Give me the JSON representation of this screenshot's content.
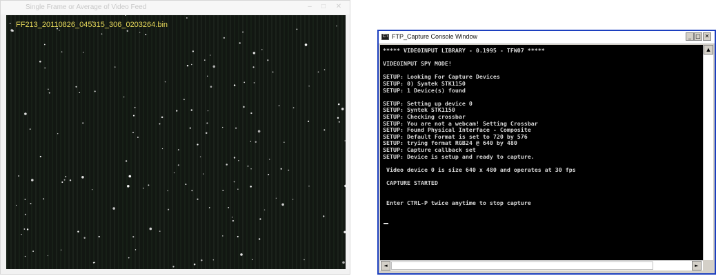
{
  "video_window": {
    "title": "Single Frame or Average of Video Feed",
    "frame_filename": "FF213_20110826_045315_306_0203264.bin",
    "controls": [
      "–",
      "□",
      "✕"
    ]
  },
  "console_window": {
    "title": "FTP_Capture Console Window",
    "controls": {
      "minimize": "_",
      "maximize": "□",
      "close": "✕"
    },
    "lines": [
      "***** VIDEOINPUT LIBRARY - 0.1995 - TFW07 *****",
      "",
      "VIDEOINPUT SPY MODE!",
      "",
      "SETUP: Looking For Capture Devices",
      "SETUP: 0) Syntek STK1150",
      "SETUP: 1 Device(s) found",
      "",
      "SETUP: Setting up device 0",
      "SETUP: Syntek STK1150",
      "SETUP: Checking crossbar",
      "SETUP: You are not a webcam! Setting Crossbar",
      "SETUP: Found Physical Interface - Composite",
      "SETUP: Default Format is set to 720 by 576",
      "SETUP: trying format RGB24 @ 640 by 480",
      "SETUP: Capture callback set",
      "SETUP: Device is setup and ready to capture.",
      "",
      " Video device 0 is size 640 x 480 and operates at 30 fps",
      "",
      " CAPTURE STARTED",
      "",
      "",
      " Enter CTRL-P twice anytime to stop capture"
    ],
    "scrollbar": {
      "up": "▲",
      "down": "▼",
      "left": "◄",
      "right": "►"
    }
  },
  "colors": {
    "frame_background": "#121712",
    "filename_text": "#e6d85a",
    "console_text": "#d8d8d8",
    "console_border": "#1c3fbf"
  }
}
